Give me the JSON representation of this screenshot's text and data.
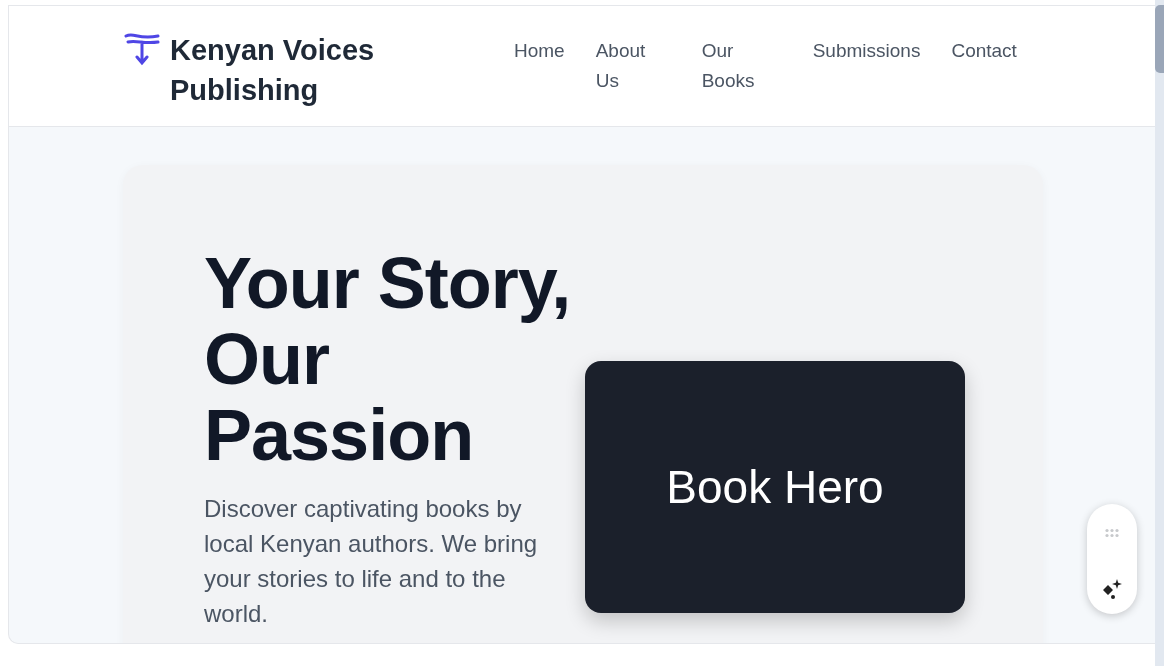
{
  "header": {
    "brand": "Kenyan Voices Publishing",
    "nav": [
      {
        "label": "Home"
      },
      {
        "label": "About Us"
      },
      {
        "label": "Our Books"
      },
      {
        "label": "Submissions"
      },
      {
        "label": "Contact"
      }
    ]
  },
  "hero": {
    "title": "Your Story, Our Passion",
    "text": "Discover captivating books by local Kenyan authors. We bring your stories to life and to the world.",
    "image_label": "Book Hero"
  }
}
